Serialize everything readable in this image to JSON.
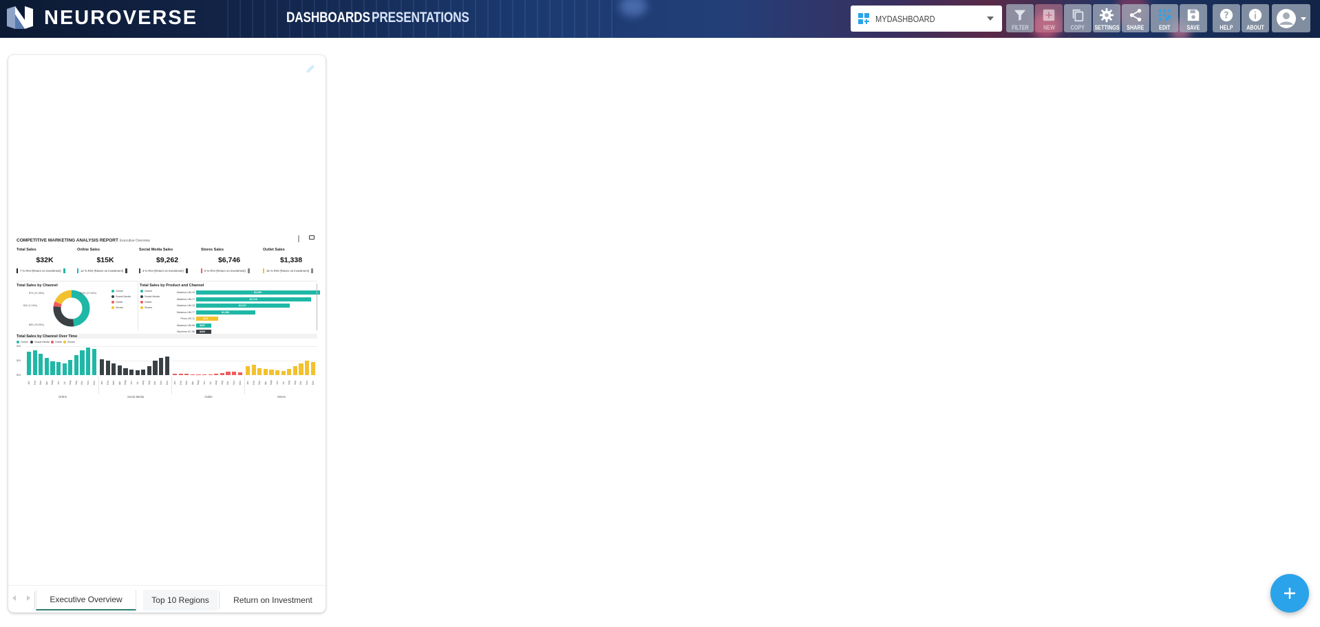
{
  "header": {
    "brand": "NEUROVERSE",
    "nav": {
      "dashboards": "DASHBOARDS",
      "presentations": "PRESENTATIONS"
    },
    "dashboard_select": {
      "value": "MYDASHBOARD"
    },
    "toolbar": {
      "filter": "FILTER",
      "new": "NEW",
      "copy": "COPY",
      "settings": "SETTINGS",
      "share": "SHARE",
      "edit": "EDIT",
      "save": "SAVE",
      "help": "HELP",
      "about": "ABOUT"
    }
  },
  "report": {
    "title": "COMPETITIVE MARKETING ANALYSIS REPORT",
    "subtitle": "Executive Overview",
    "kpis": [
      {
        "label": "Total Sales",
        "value": "$32K",
        "roi": "7 % ROI (Return on Investment)",
        "color": "#222222"
      },
      {
        "label": "Online Sales",
        "value": "$15K",
        "roi": "12 % ROI (Return on Investment)",
        "color": "#1fb8a6"
      },
      {
        "label": "Social Media Sales",
        "value": "$9,262",
        "roi": "3 % ROI (Return on Investment)",
        "color": "#3a4044"
      },
      {
        "label": "Stores Sales",
        "value": "$6,746",
        "roi": "5 % ROI (Return on Investment)",
        "color": "#ef5b5b"
      },
      {
        "label": "Outlet Sales",
        "value": "$1,338",
        "roi": "16 % ROI (Return on Investment)",
        "color": "#f2c12e"
      }
    ],
    "donut_title": "Total Sales by Channel",
    "donut_labels": [
      "$15K (47.69%)",
      "$7K (21.08%)",
      "$1K (4.16%)",
      "$9K (29.06%)"
    ],
    "channels": [
      "Online",
      "Social Media",
      "Outlet",
      "Stores"
    ],
    "bar_title": "Total Sales by Product and Channel",
    "bar_products": [
      "Maximus UM-19",
      "Maximus UM-71",
      "Maximus UM-18",
      "Maximus UM-77",
      "Pirum UR-11",
      "Maximus UM-98",
      "Maximus UC-56"
    ],
    "bar_values": [
      "$3,999",
      "$3,718",
      "$3,017",
      "$1,908",
      "$711",
      "$497",
      "$494"
    ],
    "timeline_title": "Total Sales by Channel Over Time",
    "y_ticks": [
      "$4K",
      "$2K",
      "$0K"
    ],
    "months": [
      "Jan",
      "Feb",
      "Mar",
      "Apr",
      "May",
      "Jun",
      "Jul",
      "Aug",
      "Sep",
      "Oct",
      "Nov",
      "Dec"
    ],
    "groups": [
      "Online",
      "Social Media",
      "Outlet",
      "Stores"
    ]
  },
  "colors": {
    "online": "#1fb8a6",
    "social": "#3a4044",
    "outlet": "#ef5b5b",
    "stores": "#f2c12e",
    "accent": "#2aa3ea"
  },
  "tabs": [
    "Executive Overview",
    "Top 10 Regions",
    "Return on Investment"
  ]
}
